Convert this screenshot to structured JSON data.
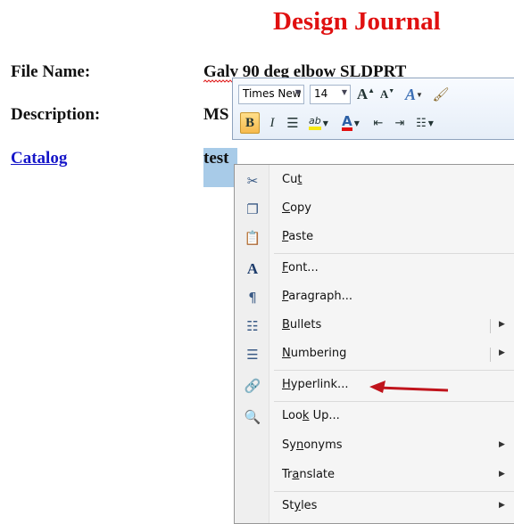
{
  "document": {
    "title": "Design Journal",
    "fields": [
      {
        "label": "File Name:",
        "value": "Galv 90 deg elbow SLDPRT"
      },
      {
        "label": "Description:",
        "value": "MS"
      },
      {
        "label": "Catalog",
        "value": "test"
      }
    ]
  },
  "mini_toolbar": {
    "font_name": "Times New",
    "font_size": "14",
    "bold": "B",
    "italic": "I",
    "grow_font_glyph": "A",
    "shrink_font_glyph": "A",
    "font_color_glyph": "A",
    "highlight_glyph": "ab"
  },
  "context_menu": {
    "items": [
      {
        "pre": "Cu",
        "key": "t",
        "post": "",
        "icon": "scissors-icon",
        "submenu": false
      },
      {
        "pre": "",
        "key": "C",
        "post": "opy",
        "icon": "copy-icon",
        "submenu": false
      },
      {
        "pre": "",
        "key": "P",
        "post": "aste",
        "icon": "paste-icon",
        "submenu": false
      },
      {
        "pre": "",
        "key": "F",
        "post": "ont...",
        "icon": "font-icon",
        "submenu": false
      },
      {
        "pre": "",
        "key": "P",
        "post": "aragraph...",
        "icon": "paragraph-icon",
        "submenu": false
      },
      {
        "pre": "",
        "key": "B",
        "post": "ullets",
        "icon": "bullets-icon",
        "submenu": true
      },
      {
        "pre": "",
        "key": "N",
        "post": "umbering",
        "icon": "numbering-icon",
        "submenu": true
      },
      {
        "pre": "",
        "key": "H",
        "post": "yperlink...",
        "icon": "hyperlink-icon",
        "submenu": false
      },
      {
        "pre": "Loo",
        "key": "k",
        "post": " Up...",
        "icon": "lookup-icon",
        "submenu": false
      },
      {
        "pre": "Sy",
        "key": "n",
        "post": "onyms",
        "icon": "",
        "submenu": true
      },
      {
        "pre": "Tr",
        "key": "a",
        "post": "nslate",
        "icon": "",
        "submenu": true
      },
      {
        "pre": "St",
        "key": "y",
        "post": "les",
        "icon": "",
        "submenu": true
      }
    ]
  },
  "colors": {
    "title": "#e01010",
    "link": "#1515c8",
    "selection": "#a8cbe8",
    "annotation_arrow": "#c0141c"
  }
}
